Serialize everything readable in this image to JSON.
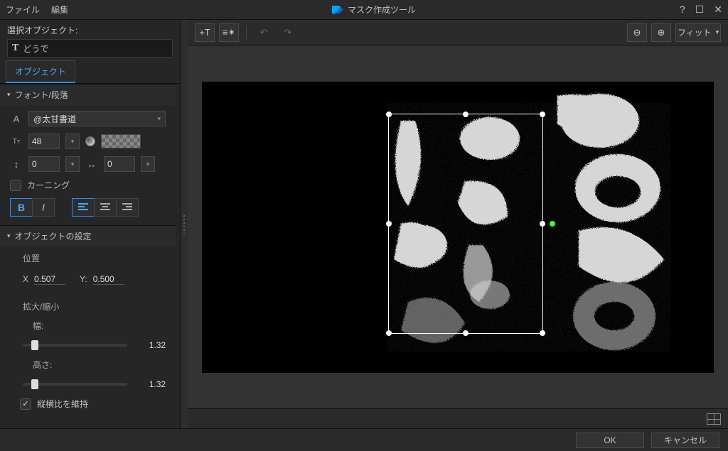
{
  "titlebar": {
    "menu_file": "ファイル",
    "menu_edit": "編集",
    "app_title": "マスク作成ツール"
  },
  "left": {
    "selection_label": "選択オブジェクト:",
    "selection_value": "どうで",
    "tab_object": "オブジェクト",
    "section_font": "フォント/段落",
    "font_name": "@太甘書道",
    "font_size": "48",
    "line_spacing": "0",
    "char_spacing": "0",
    "kerning_label": "カーニング",
    "section_object": "オブジェクトの設定",
    "position_label": "位置",
    "pos_x_label": "X",
    "pos_x": "0.507",
    "pos_y_label": "Y:",
    "pos_y": "0.500",
    "scale_label": "拡大/縮小",
    "width_label": "幅:",
    "width_val": "1.32",
    "height_label": "高さ:",
    "height_val": "1.32",
    "keep_aspect": "縦横比を維持"
  },
  "toolbar": {
    "add_text": "+T",
    "add_shape": "≡✶",
    "fit": "フィット"
  },
  "footer": {
    "ok": "OK",
    "cancel": "キャンセル"
  },
  "colors": {
    "accent": "#1e90ff"
  }
}
